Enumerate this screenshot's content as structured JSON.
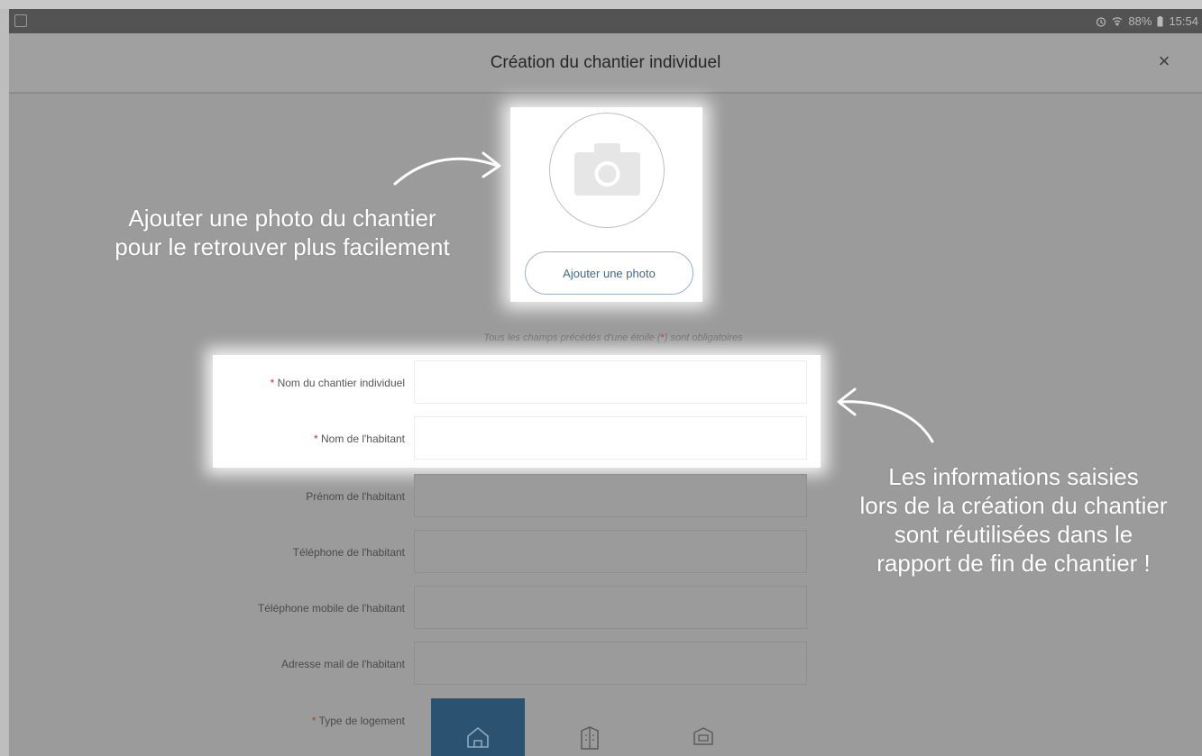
{
  "status_bar": {
    "battery": "88%",
    "time": "15:54"
  },
  "header": {
    "title": "Création du chantier individuel",
    "close_label": "×"
  },
  "photo": {
    "add_button_label": "Ajouter une photo"
  },
  "annotations": {
    "left_line1": "Ajouter une photo du chantier",
    "left_line2": "pour le retrouver plus facilement",
    "right_line1": "Les informations saisies",
    "right_line2": "lors de la création du chantier",
    "right_line3": "sont réutilisées dans le",
    "right_line4": "rapport de fin de chantier !"
  },
  "form": {
    "required_note_before": "Tous les champs précédés d'une étoile (",
    "required_note_star": "*",
    "required_note_after": ") sont obligatoires",
    "fields": [
      {
        "label": "Nom du chantier individuel",
        "required": true,
        "value": ""
      },
      {
        "label": "Nom de l'habitant",
        "required": true,
        "value": ""
      },
      {
        "label": "Prénom de l'habitant",
        "required": false,
        "value": ""
      },
      {
        "label": "Téléphone de l'habitant",
        "required": false,
        "value": ""
      },
      {
        "label": "Téléphone mobile de l'habitant",
        "required": false,
        "value": ""
      },
      {
        "label": "Adresse mail de l'habitant",
        "required": false,
        "value": ""
      }
    ],
    "type_label": "Type de logement",
    "star": "*",
    "type_options": [
      {
        "icon": "house-icon",
        "selected": true
      },
      {
        "icon": "building-icon",
        "selected": false
      },
      {
        "icon": "apartment-icon",
        "selected": false
      }
    ]
  },
  "colors": {
    "accent": "#2c5271",
    "required_star": "#c0392b",
    "overlay_bg": "#9b9b9b"
  }
}
